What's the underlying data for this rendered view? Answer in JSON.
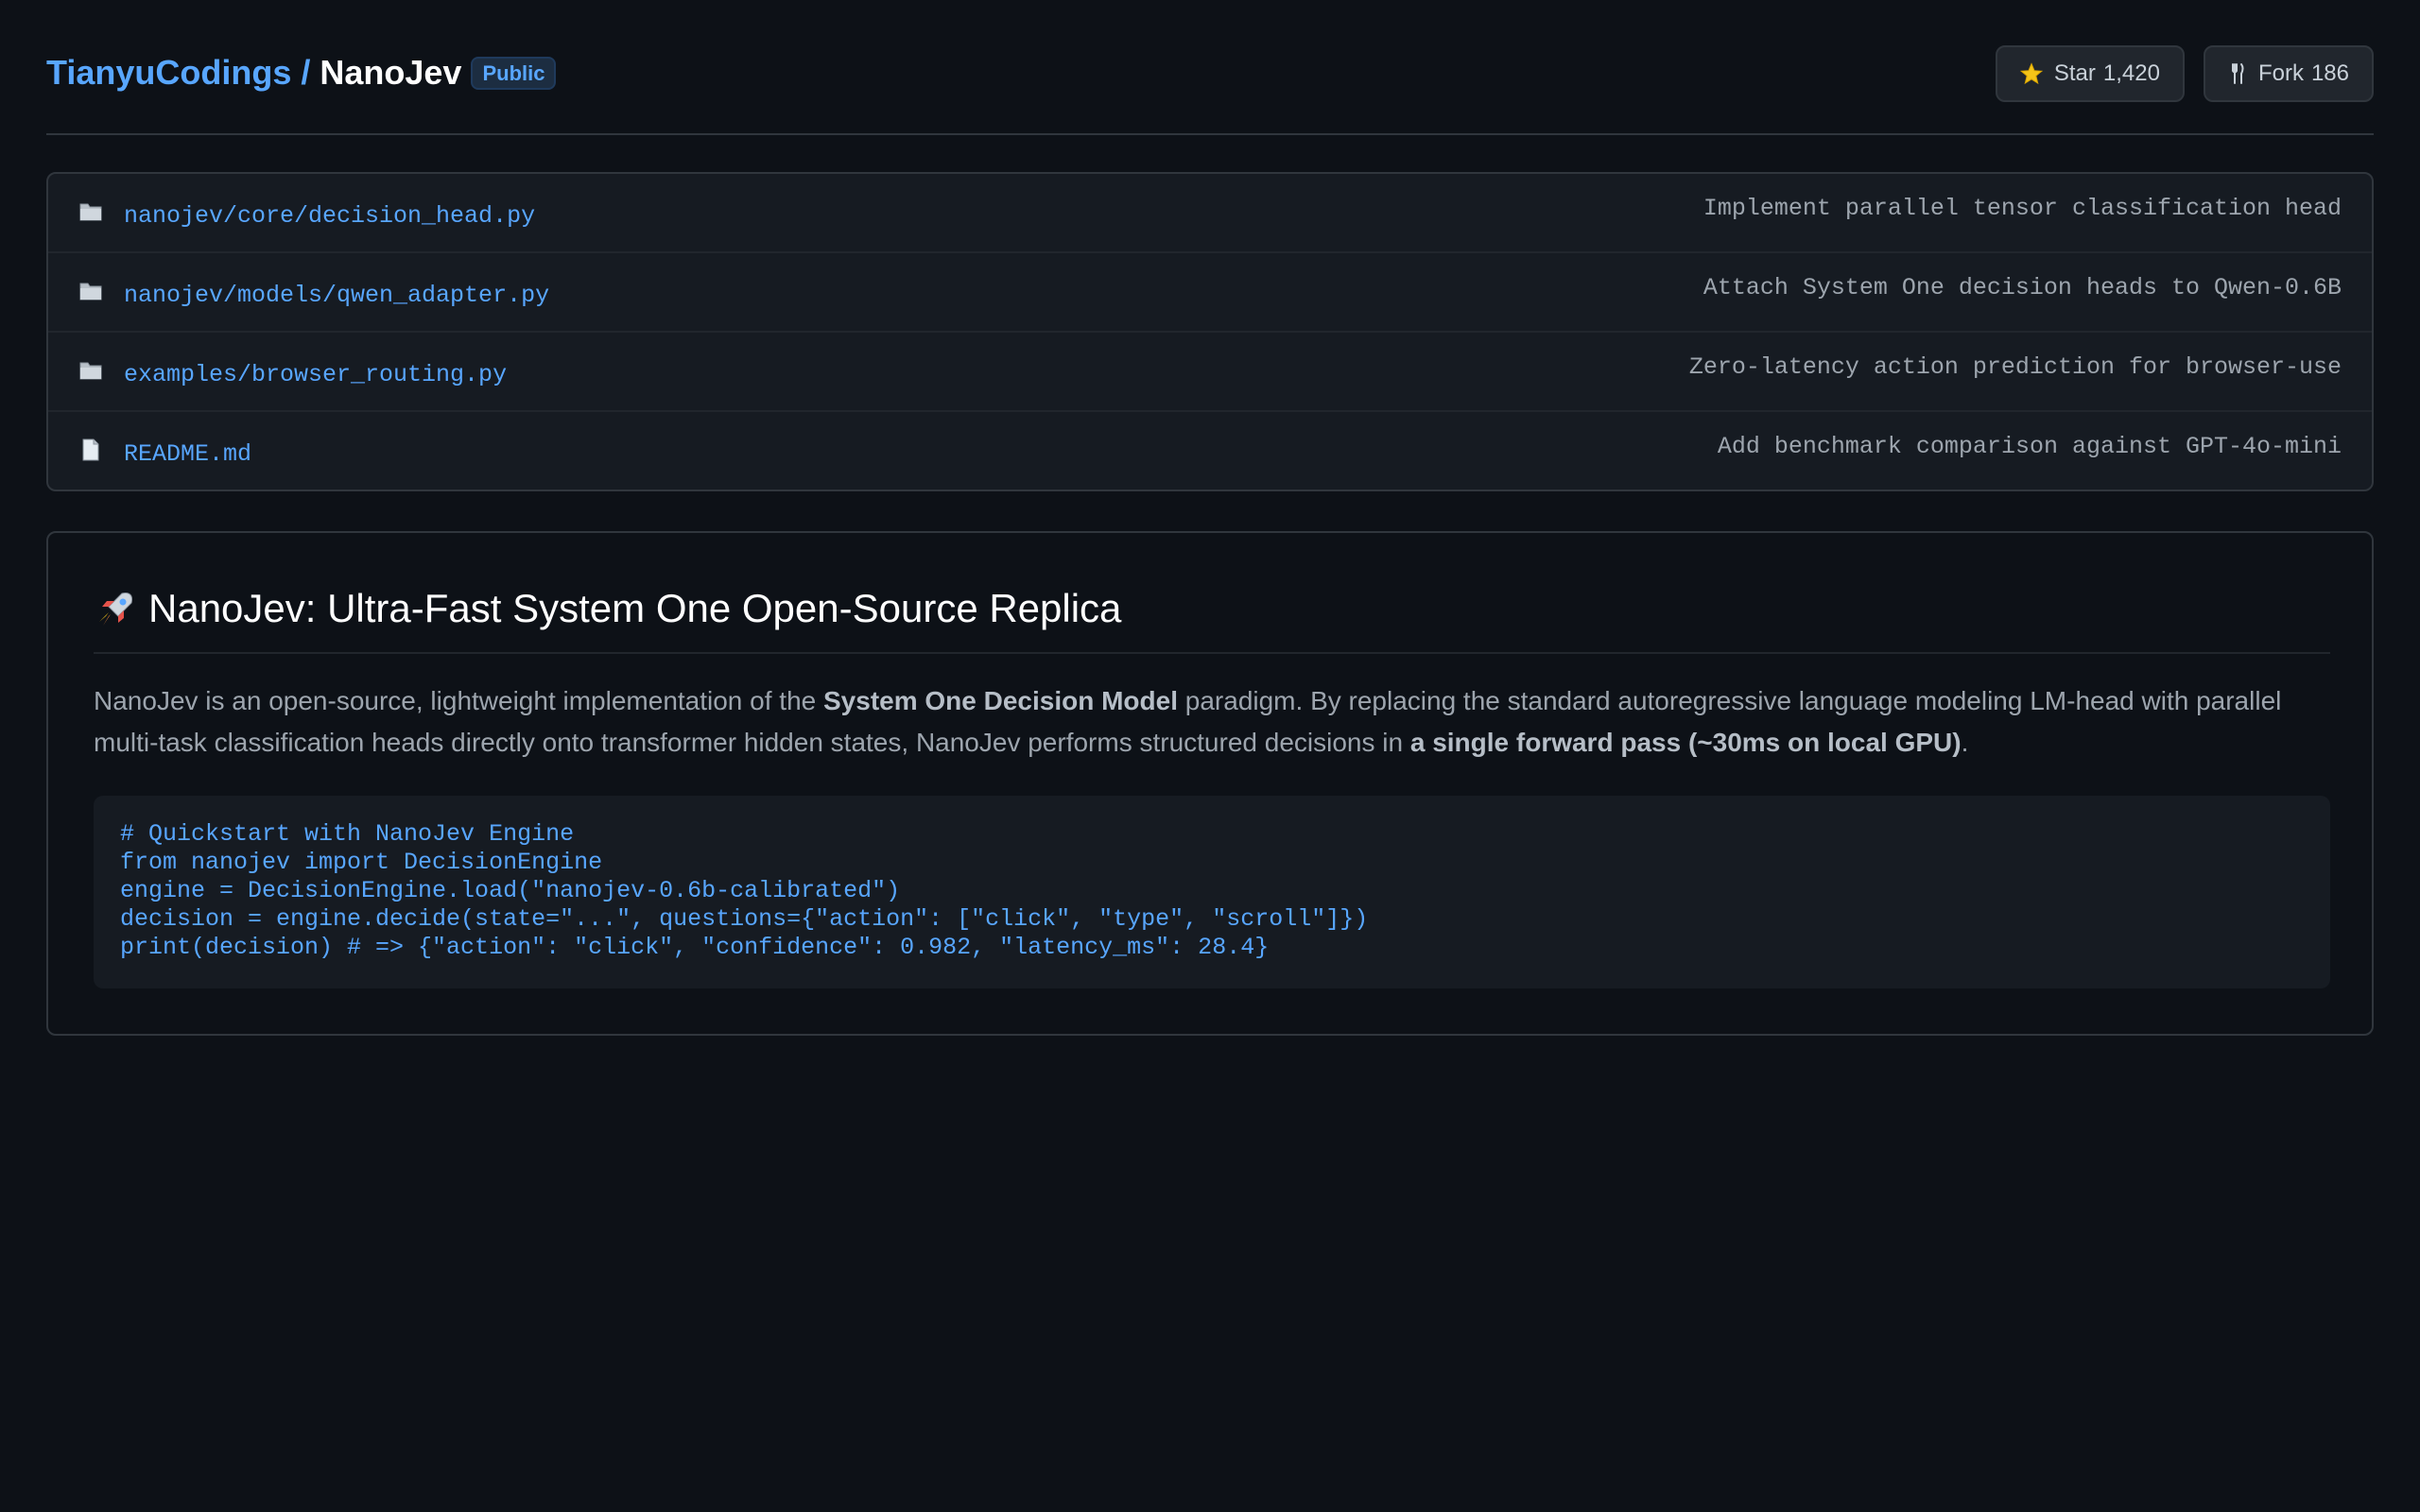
{
  "repo": {
    "owner": "TianyuCodings",
    "separator": "/",
    "name": "NanoJev",
    "visibility": "Public"
  },
  "actions": {
    "star": {
      "label": "Star",
      "count": "1,420",
      "icon": "star-icon"
    },
    "fork": {
      "label": "Fork",
      "count": "186",
      "icon": "fork-icon"
    }
  },
  "files": [
    {
      "type": "folder",
      "name": "nanojev/core/decision_head.py",
      "commit": "Implement parallel tensor classification head"
    },
    {
      "type": "folder",
      "name": "nanojev/models/qwen_adapter.py",
      "commit": "Attach System One decision heads to Qwen-0.6B"
    },
    {
      "type": "folder",
      "name": "examples/browser_routing.py",
      "commit": "Zero-latency action prediction for browser-use"
    },
    {
      "type": "file",
      "name": "README.md",
      "commit": "Add benchmark comparison against GPT-4o-mini"
    }
  ],
  "readme": {
    "heading": "NanoJev: Ultra-Fast System One Open-Source Replica",
    "heading_icon": "rocket-icon",
    "paragraph": {
      "part1": "NanoJev is an open-source, lightweight implementation of the ",
      "bold1": "System One Decision Model",
      "part2": " paradigm. By replacing the standard autoregressive language modeling LM-head with parallel multi-task classification heads directly onto transformer hidden states, NanoJev performs structured decisions in ",
      "bold2": "a single forward pass (~30ms on local GPU)",
      "part3": "."
    },
    "code": [
      "# Quickstart with NanoJev Engine",
      "from nanojev import DecisionEngine",
      "engine = DecisionEngine.load(\"nanojev-0.6b-calibrated\")",
      "decision = engine.decide(state=\"...\", questions={\"action\": [\"click\", \"type\", \"scroll\"]})",
      "print(decision) # => {\"action\": \"click\", \"confidence\": 0.982, \"latency_ms\": 28.4}"
    ]
  },
  "colors": {
    "background": "#0d1117",
    "link": "#58a6ff",
    "border": "#30363d",
    "panel": "#161b22"
  }
}
